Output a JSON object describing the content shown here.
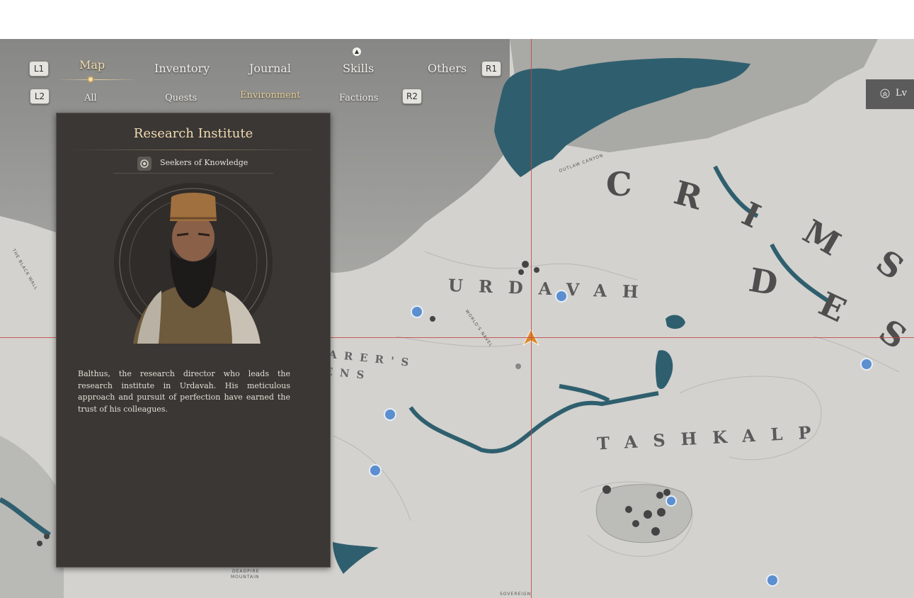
{
  "nav": {
    "left_top_key": "L1",
    "right_top_key": "R1",
    "left_sub_key": "L2",
    "right_sub_key": "R2",
    "tabs": [
      {
        "label": "Map",
        "active": true
      },
      {
        "label": "Inventory",
        "active": false
      },
      {
        "label": "Journal",
        "active": false
      },
      {
        "label": "Skills",
        "active": false
      },
      {
        "label": "Others",
        "active": false
      }
    ],
    "subtabs": [
      {
        "label": "All",
        "active": false
      },
      {
        "label": "Quests",
        "active": false
      },
      {
        "label": "Environment",
        "active": true
      },
      {
        "label": "Factions",
        "active": false
      }
    ]
  },
  "level_badge": {
    "label": "Lv"
  },
  "panel": {
    "title": "Research Institute",
    "faction": "Seekers of Knowledge",
    "description": "Balthus, the research director who leads the research institute in Urdavah. His meticulous approach and pursuit of perfection have earned the trust of his colleagues."
  },
  "map": {
    "regions": {
      "urdavah": "URDAVAH",
      "tashkalp": "TASHKALP",
      "crimson_deserts": "CRIMSON DESERTS",
      "crimson_c": "C",
      "crimson_r": "R",
      "crimson_i": "I",
      "crimson_m": "M",
      "crimson_s": "S",
      "desert_d": "D",
      "desert_e": "E",
      "desert_s": "S",
      "bearers_line1": "BEARER'S",
      "bearers_line2": "RENS"
    },
    "labels": {
      "outlaw_canyon": "OUTLAW CANYON",
      "deadpire_mountain_1": "DEADPIRE",
      "deadpire_mountain_2": "MOUNTAIN",
      "sovereign": "SOVEREIGN",
      "the_black_wall": "THE BLACK WALL",
      "worlds_navel": "WORLD'S NAVEL"
    }
  },
  "colors": {
    "water": "#2f5f6e",
    "fog": "#8f8f8c",
    "land": "#d1d0cc",
    "panel_bg": "#3a3735",
    "accent_gold": "#f1dbb1",
    "crosshair": "#c8463f",
    "poi_blue": "#5b8fcf"
  }
}
